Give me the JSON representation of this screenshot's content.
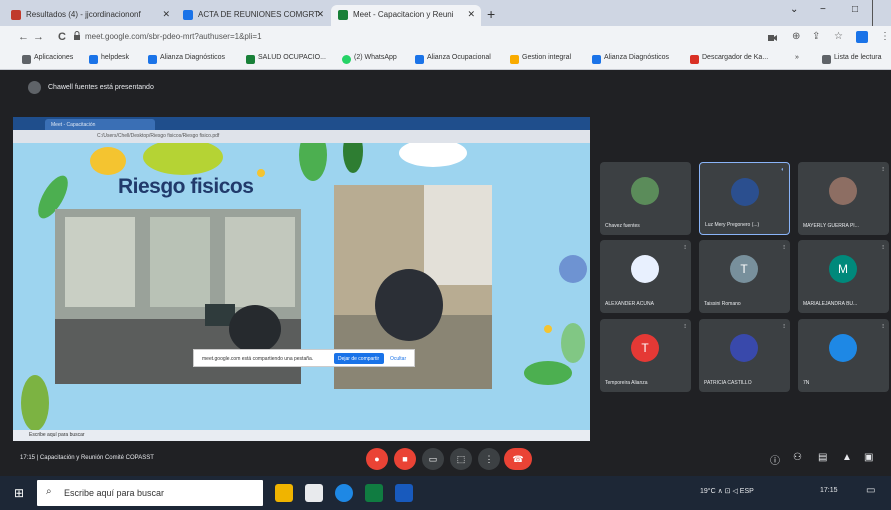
{
  "browser": {
    "tabs": [
      {
        "label": "Resultados (4) - jjcordinaciononf",
        "close": "✕",
        "fav_color": "#c0392b"
      },
      {
        "label": "ACTA DE REUNIONES COMGRT",
        "close": "✕",
        "fav_color": "#1a73e8"
      },
      {
        "label": "Meet - Capacitacion y Reuni",
        "close": "✕",
        "fav_color": "#188038"
      }
    ],
    "new_tab": "+",
    "window_controls": [
      "⌄",
      "−",
      "□"
    ],
    "url": "meet.google.com/sbr-pdeo-mrt?authuser=1&pli=1",
    "nav": {
      "back": "←",
      "forward": "→",
      "reload": "C"
    },
    "bookmarks": [
      {
        "label": "Aplicaciones",
        "color": "#5f6368"
      },
      {
        "label": "helpdesk",
        "color": "#1a73e8"
      },
      {
        "label": "Alianza Diagnósticos",
        "color": "#1a73e8"
      },
      {
        "label": "SALUD OCUPACIO...",
        "color": "#188038"
      },
      {
        "label": "(2) WhatsApp",
        "color": "#25d366"
      },
      {
        "label": "Alianza Ocupacional",
        "color": "#1a73e8"
      },
      {
        "label": "Gestion integral",
        "color": "#f9ab00"
      },
      {
        "label": "Alianza Diagnósticos",
        "color": "#1a73e8"
      },
      {
        "label": "Descargador de Ka...",
        "color": "#d93025"
      },
      {
        "label": "Lista de lectura",
        "color": "#5f6368"
      }
    ],
    "bookmarks_more": "»"
  },
  "meet": {
    "presenting_text": "Chawell fuentes está presentando",
    "shared": {
      "inner_tab": "Meet - Capacitación",
      "inner_url": "C:/Users/Chell/Desktop/Riesgo fisicos/Riesgo fisico.pdf",
      "slide_title": "Riesgo fisicos",
      "share_message": "meet.google.com está compartiendo una pestaña.",
      "stop_label": "Dejar de compartir",
      "hide_label": "Ocultar",
      "taskbar_search": "Escribe aquí para buscar"
    },
    "participants": [
      {
        "name": "Chavez fuentes",
        "initial": "",
        "color": "#5b8c5a",
        "active": false
      },
      {
        "name": "Luz Mery Pregonero (...)",
        "initial": "",
        "color": "#2b4f8f",
        "active": true
      },
      {
        "name": "MAYERLY GUERRA PI...",
        "initial": "",
        "color": "#8d6e63",
        "active": false
      },
      {
        "name": "ALEXANDER ACUÑA",
        "initial": "",
        "color": "#e8f0fe",
        "active": false
      },
      {
        "name": "Taissini Romano",
        "initial": "T",
        "color": "#78909c",
        "active": false
      },
      {
        "name": "MARIALEJANDRA BU...",
        "initial": "M",
        "color": "#00897b",
        "active": false
      },
      {
        "name": "Temporeira Alianza",
        "initial": "T",
        "color": "#e53935",
        "active": false
      },
      {
        "name": "PATRICIA CASTILLO",
        "initial": "",
        "color": "#3949ab",
        "active": false
      },
      {
        "name": "7N",
        "initial": "",
        "color": "#1e88e5",
        "active": false
      }
    ],
    "mic_icon": "⁝",
    "meeting_name": "Capacitación y Reunión Comité COPASST",
    "time": "17:15"
  },
  "taskbar": {
    "search_placeholder": "Escribe aquí para buscar",
    "start_icon": "⊞",
    "tray_text": "19°C ∧ ⊡ ◁ ESP",
    "clock": "17:15"
  }
}
